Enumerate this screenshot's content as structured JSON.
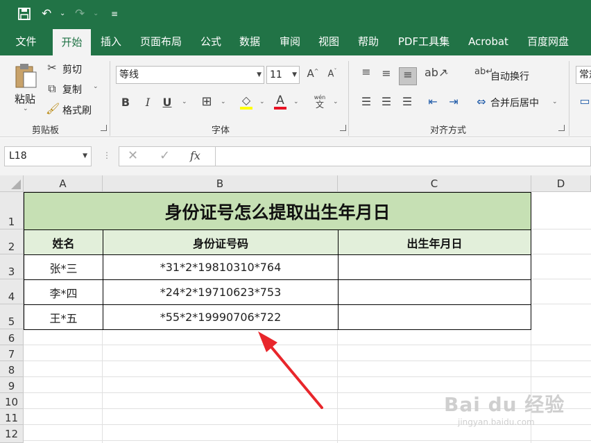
{
  "qat": {
    "save_icon": "save-icon",
    "undo_icon": "undo-icon",
    "redo_icon": "redo-icon"
  },
  "tabs": [
    {
      "label": "文件"
    },
    {
      "label": "开始"
    },
    {
      "label": "插入"
    },
    {
      "label": "页面布局"
    },
    {
      "label": "公式"
    },
    {
      "label": "数据"
    },
    {
      "label": "审阅"
    },
    {
      "label": "视图"
    },
    {
      "label": "帮助"
    },
    {
      "label": "PDF工具集"
    },
    {
      "label": "Acrobat"
    },
    {
      "label": "百度网盘"
    }
  ],
  "ribbon": {
    "clipboard": {
      "paste": "粘贴",
      "cut": "剪切",
      "copy": "复制",
      "format_painter": "格式刷",
      "group": "剪贴板"
    },
    "font": {
      "family": "等线",
      "size": "11",
      "group": "字体",
      "bold": "B",
      "italic": "I",
      "underline": "U",
      "font_color": "A",
      "phonetic": "wén"
    },
    "align": {
      "wrap": "自动换行",
      "merge": "合并后居中",
      "group": "对齐方式"
    },
    "number": {
      "format": "常规"
    }
  },
  "formula_bar": {
    "name_box": "L18",
    "fx": "fx",
    "formula": ""
  },
  "columns": [
    "A",
    "B",
    "C",
    "D"
  ],
  "rows": [
    "1",
    "2",
    "3",
    "4",
    "5",
    "6",
    "7",
    "8",
    "9",
    "10",
    "11",
    "12"
  ],
  "sheet": {
    "title": "身份证号怎么提取出生年月日",
    "headers": [
      "姓名",
      "身份证号码",
      "出生年月日"
    ],
    "data": [
      [
        "张*三",
        "*31*2*19810310*764",
        ""
      ],
      [
        "李*四",
        "*24*2*19710623*753",
        ""
      ],
      [
        "王*五",
        "*55*2*19990706*722",
        ""
      ]
    ]
  },
  "watermark": {
    "brand": "Bai du 经验",
    "url": "jingyan.baidu.com"
  }
}
